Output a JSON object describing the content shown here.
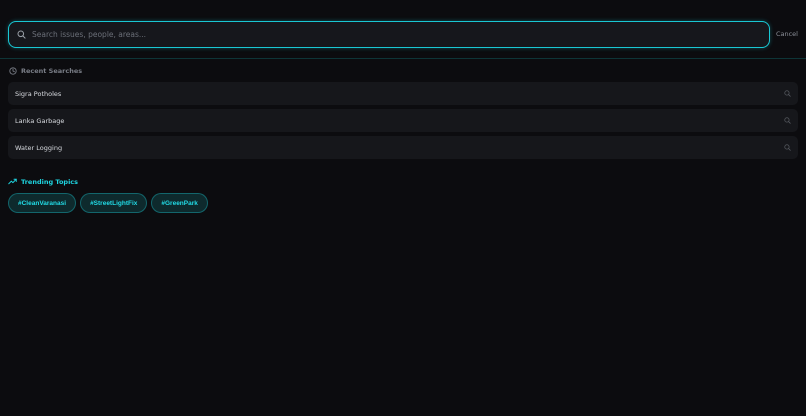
{
  "search": {
    "placeholder": "Search issues, people, areas...",
    "value": "",
    "cancel_label": "Cancel"
  },
  "recent": {
    "heading": "Recent Searches",
    "icon": "clock-icon",
    "items": [
      {
        "label": "Sigra Potholes",
        "icon": "search-icon"
      },
      {
        "label": "Lanka Garbage",
        "icon": "search-icon"
      },
      {
        "label": "Water Logging",
        "icon": "search-icon"
      }
    ]
  },
  "trending": {
    "heading": "Trending Topics",
    "icon": "trending-up-icon",
    "topics": [
      "#CleanVaranasi",
      "#StreetLightFix",
      "#GreenPark"
    ]
  },
  "colors": {
    "background": "#0c0c0f",
    "accent": "#19c7d3",
    "surface": "#16171b",
    "chip_bg": "#0e2a2d",
    "muted_text": "#7a7e87"
  }
}
